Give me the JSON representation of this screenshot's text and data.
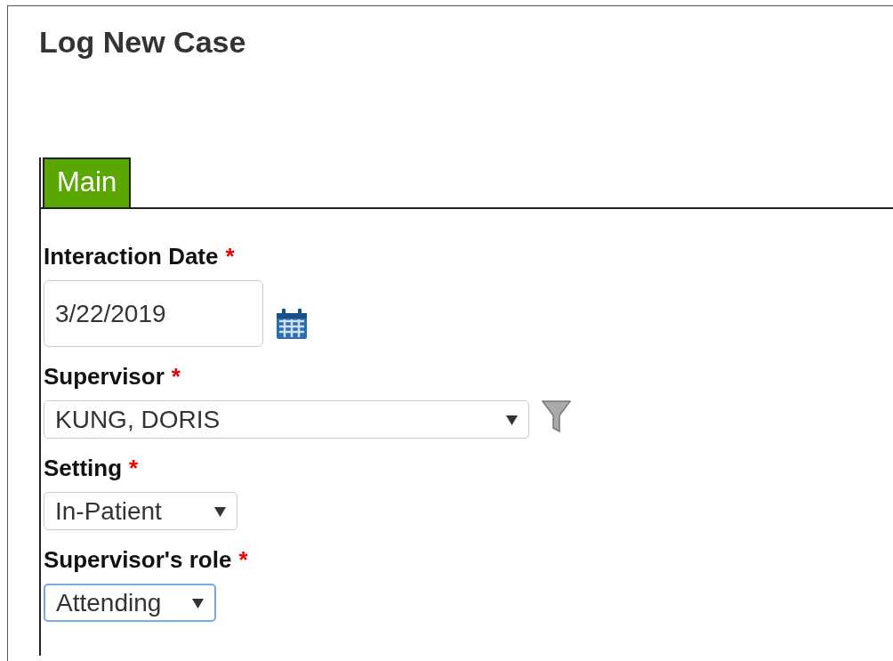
{
  "title": "Log New Case",
  "tabs": [
    {
      "label": "Main",
      "selected": true
    }
  ],
  "fields": [
    {
      "label": "Interaction Date",
      "required_mark": "*",
      "kind": "date",
      "value": "3/22/2019",
      "focused": false
    },
    {
      "label": "Supervisor",
      "required_mark": "*",
      "kind": "filterselect",
      "value": "KUNG, DORIS",
      "focused": false
    },
    {
      "label": "Setting",
      "required_mark": "*",
      "kind": "select",
      "value": "In-Patient",
      "focused": false
    },
    {
      "label": "Supervisor's role",
      "required_mark": "*",
      "kind": "select",
      "value": "Attending",
      "focused": true
    }
  ]
}
